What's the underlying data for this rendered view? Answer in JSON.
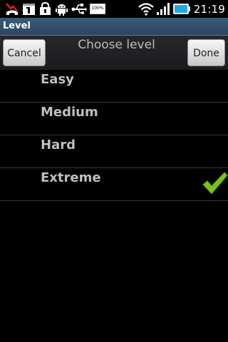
{
  "status_bar": {
    "battery_label": "100%",
    "clock": "21:19",
    "icons": [
      "missed-call-icon",
      "calendar-icon",
      "lock-icon",
      "android-debug-icon",
      "usb-icon",
      "battery-level-icon",
      "wifi-icon",
      "signal-icon",
      "battery-icon"
    ]
  },
  "app": {
    "title": "Level"
  },
  "header": {
    "title": "Choose level",
    "cancel_label": "Cancel",
    "done_label": "Done"
  },
  "levels": [
    {
      "label": "Easy",
      "selected": false
    },
    {
      "label": "Medium",
      "selected": false
    },
    {
      "label": "Hard",
      "selected": false
    },
    {
      "label": "Extreme",
      "selected": true
    }
  ],
  "colors": {
    "title_bar": "#2b4561",
    "check": "#7cc219",
    "item_text": "#bfbfbf"
  }
}
